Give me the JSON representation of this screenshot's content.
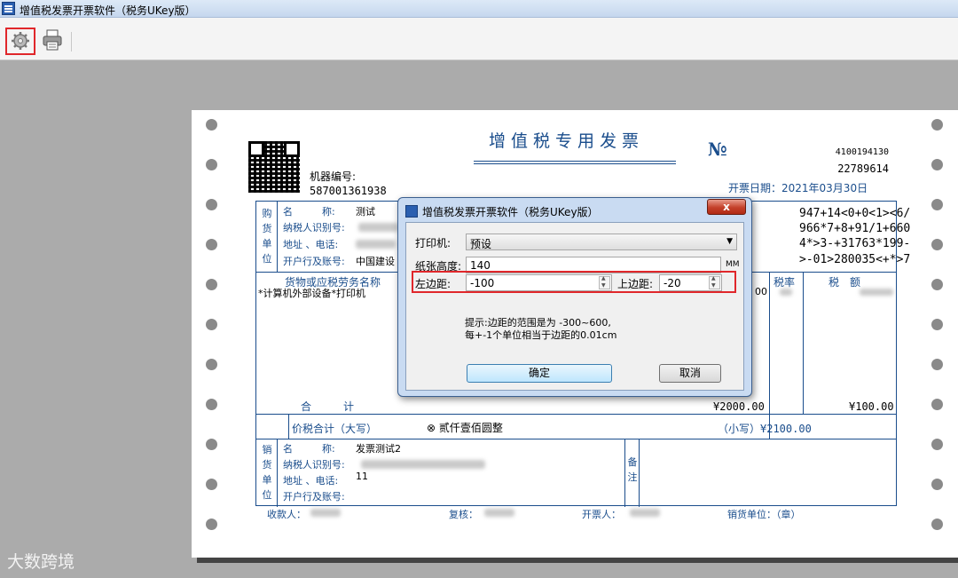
{
  "window": {
    "title": "增值税发票开票软件（税务UKey版）"
  },
  "toolbar": {
    "settings_icon": "gear-icon",
    "print_icon": "printer-icon"
  },
  "invoice": {
    "title": "增值税专用发票",
    "no_mark": "№",
    "code_small": "4100194130",
    "code_number": "22789614",
    "machine_label": "机器编号:",
    "machine_no": "587001361938",
    "date": "开票日期：2021年03月30日",
    "buyer": {
      "side_label": "购货单位",
      "name_label": "名　　　称:",
      "name_value": "测试",
      "tax_id_label": "纳税人识别号:",
      "addr_label": "地址 、电话:",
      "bank_label": "开户行及账号:",
      "bank_value": "中国建设"
    },
    "cipher_lines": [
      "947+14<0+0<1><6/",
      "966*7+8+91/1+660",
      "4*>3-+31763*199-",
      ">-01>280035<+*>7"
    ],
    "items_header": "货物或应税劳务名称",
    "item_line": "*计算机外部设备*打印机",
    "tax_rate_header": "税率",
    "tax_amount_header": "税　额",
    "partial_amount": "00",
    "total_label": "合　　　计",
    "total_amount": "¥2000.00",
    "total_tax": "¥100.00",
    "sum_label": "价税合计（大写）",
    "sum_words": "⊗ 贰仟壹佰圆整",
    "sum_small": "（小写）¥2100.00",
    "seller": {
      "side_label": "销货单位",
      "name_label": "名　　　称:",
      "name_value": "发票测试2",
      "tax_id_label": "纳税人识别号:",
      "addr_label": "地址 、电话:",
      "addr_value": "11",
      "bank_label": "开户行及账号:"
    },
    "remark_label": "备注",
    "payee_label": "收款人：",
    "reviewer_label": "复核：",
    "drawer_label": "开票人：",
    "seller_seal_label": "销货单位：（章）"
  },
  "dialog": {
    "title": "增值税发票开票软件（税务UKey版）",
    "close_label": "x",
    "printer_label": "打印机:",
    "printer_value": "预设",
    "paper_height_label": "纸张高度:",
    "paper_height_value": "140",
    "paper_height_unit": "MM",
    "left_margin_label": "左边距:",
    "left_margin_value": "-100",
    "top_margin_label": "上边距:",
    "top_margin_value": "-20",
    "hint_line1": "提示:边距的范围是为 -300~600,",
    "hint_line2": "每+-1个单位相当于边距的0.01cm",
    "ok_label": "确定",
    "cancel_label": "取消"
  },
  "watermark": "大数跨境"
}
